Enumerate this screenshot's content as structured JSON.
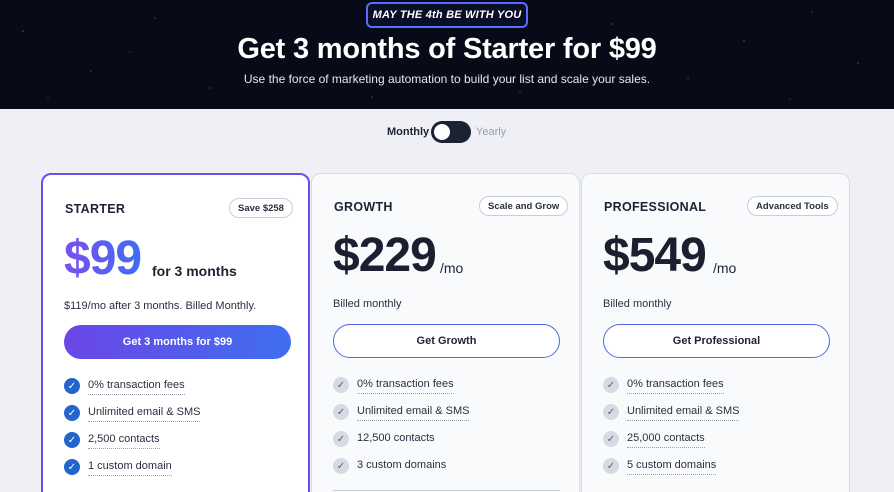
{
  "hero": {
    "badge": "MAY THE 4th BE WITH YOU",
    "title": "Get 3 months of Starter for $99",
    "subtitle": "Use the force of marketing automation to build your list and scale your sales."
  },
  "billing_toggle": {
    "monthly_label": "Monthly",
    "yearly_label": "Yearly",
    "selected": "Monthly"
  },
  "plans": [
    {
      "name": "STARTER",
      "tag": "Save $258",
      "price": "$99",
      "price_suffix": "for 3 months",
      "billing_note": "$119/mo after 3 months. Billed Monthly.",
      "cta_label": "Get 3 months for $99",
      "features": [
        "0% transaction fees",
        "Unlimited email & SMS",
        "2,500 contacts",
        "1 custom domain"
      ]
    },
    {
      "name": "GROWTH",
      "tag": "Scale and Grow",
      "price": "$229",
      "price_suffix": "/mo",
      "billing_note": "Billed monthly",
      "cta_label": "Get Growth",
      "features": [
        "0% transaction fees",
        "Unlimited email & SMS",
        "12,500 contacts",
        "3 custom domains"
      ]
    },
    {
      "name": "PROFESSIONAL",
      "tag": "Advanced Tools",
      "price": "$549",
      "price_suffix": "/mo",
      "billing_note": "Billed monthly",
      "cta_label": "Get Professional",
      "features": [
        "0% transaction fees",
        "Unlimited email & SMS",
        "25,000 contacts",
        "5 custom domains"
      ]
    }
  ],
  "colors": {
    "accent_purple": "#6a4ee8",
    "accent_blue": "#3f6ef0",
    "check_blue": "#2266cc",
    "hero_bg": "#070b17"
  },
  "icons": {
    "feature_check": "check-circle-icon"
  }
}
